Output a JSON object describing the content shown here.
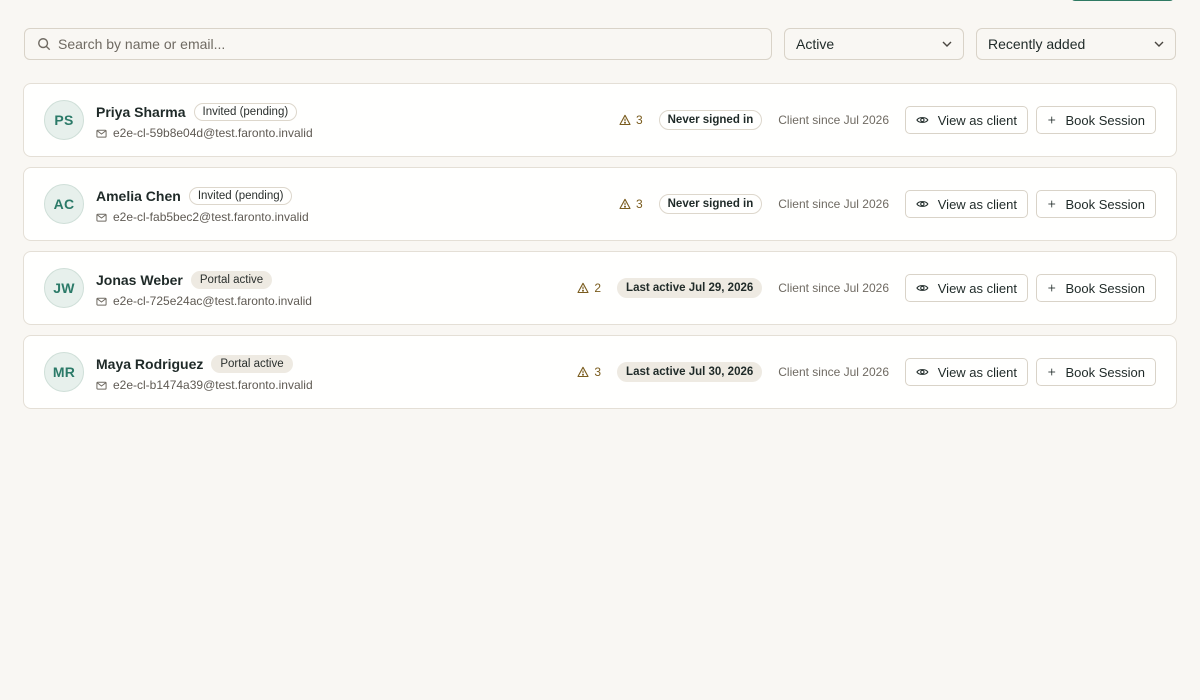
{
  "search": {
    "placeholder": "Search by name or email..."
  },
  "filters": {
    "status": "Active",
    "sort": "Recently added"
  },
  "clients": [
    {
      "initials": "PS",
      "name": "Priya Sharma",
      "status": "Invited (pending)",
      "email": "e2e-cl-59b8e04d@test.faronto.invalid",
      "alerts": "3",
      "activity": "Never signed in",
      "since": "Client since Jul 2026",
      "view_label": "View as client",
      "book_label": "Book Session"
    },
    {
      "initials": "AC",
      "name": "Amelia Chen",
      "status": "Invited (pending)",
      "email": "e2e-cl-fab5bec2@test.faronto.invalid",
      "alerts": "3",
      "activity": "Never signed in",
      "since": "Client since Jul 2026",
      "view_label": "View as client",
      "book_label": "Book Session"
    },
    {
      "initials": "JW",
      "name": "Jonas Weber",
      "status": "Portal active",
      "email": "e2e-cl-725e24ac@test.faronto.invalid",
      "alerts": "2",
      "activity": "Last active Jul 29, 2026",
      "since": "Client since Jul 2026",
      "view_label": "View as client",
      "book_label": "Book Session"
    },
    {
      "initials": "MR",
      "name": "Maya Rodriguez",
      "status": "Portal active",
      "email": "e2e-cl-b1474a39@test.faronto.invalid",
      "alerts": "3",
      "activity": "Last active Jul 30, 2026",
      "since": "Client since Jul 2026",
      "view_label": "View as client",
      "book_label": "Book Session"
    }
  ],
  "icons": {
    "search": "search-icon",
    "dropdown": "chevron-down-icon",
    "email": "mail-icon",
    "alert": "warning-triangle-icon",
    "view": "eye-icon",
    "book": "plus-icon"
  },
  "colors": {
    "background": "#f9f7f3",
    "accent": "#2f7a63",
    "avatar_text": "#2b7a68",
    "avatar_bg": "#e7f0ec",
    "alert": "#7a5c1e"
  }
}
